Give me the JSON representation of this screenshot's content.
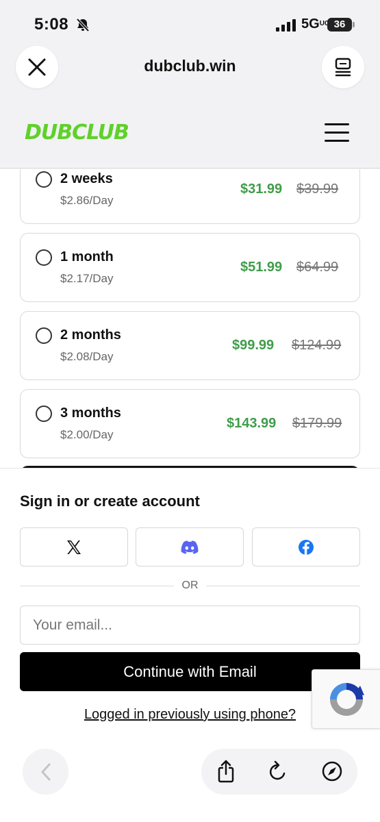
{
  "status_bar": {
    "time": "5:08",
    "network": "5G",
    "network_suffix": "UC",
    "battery": "36"
  },
  "browser": {
    "url": "dubclub.win"
  },
  "site": {
    "logo": "DUBCLUB"
  },
  "plans": [
    {
      "name": "2 weeks",
      "per_day": "$2.86/Day",
      "price": "$31.99",
      "old_price": "$39.99"
    },
    {
      "name": "1 month",
      "per_day": "$2.17/Day",
      "price": "$51.99",
      "old_price": "$64.99"
    },
    {
      "name": "2 months",
      "per_day": "$2.08/Day",
      "price": "$99.99",
      "old_price": "$124.99"
    },
    {
      "name": "3 months",
      "per_day": "$2.00/Day",
      "price": "$143.99",
      "old_price": "$179.99"
    }
  ],
  "signin": {
    "title": "Sign in or create account",
    "providers": [
      "x-icon",
      "discord-icon",
      "facebook-icon"
    ],
    "or_label": "OR",
    "email_placeholder": "Your email...",
    "continue_label": "Continue with Email",
    "phone_link": "Logged in previously using phone?"
  },
  "colors": {
    "price_green": "#3f9d4a",
    "logo_green": "#5fd12a",
    "discord": "#5865F2",
    "facebook": "#1877F2"
  }
}
